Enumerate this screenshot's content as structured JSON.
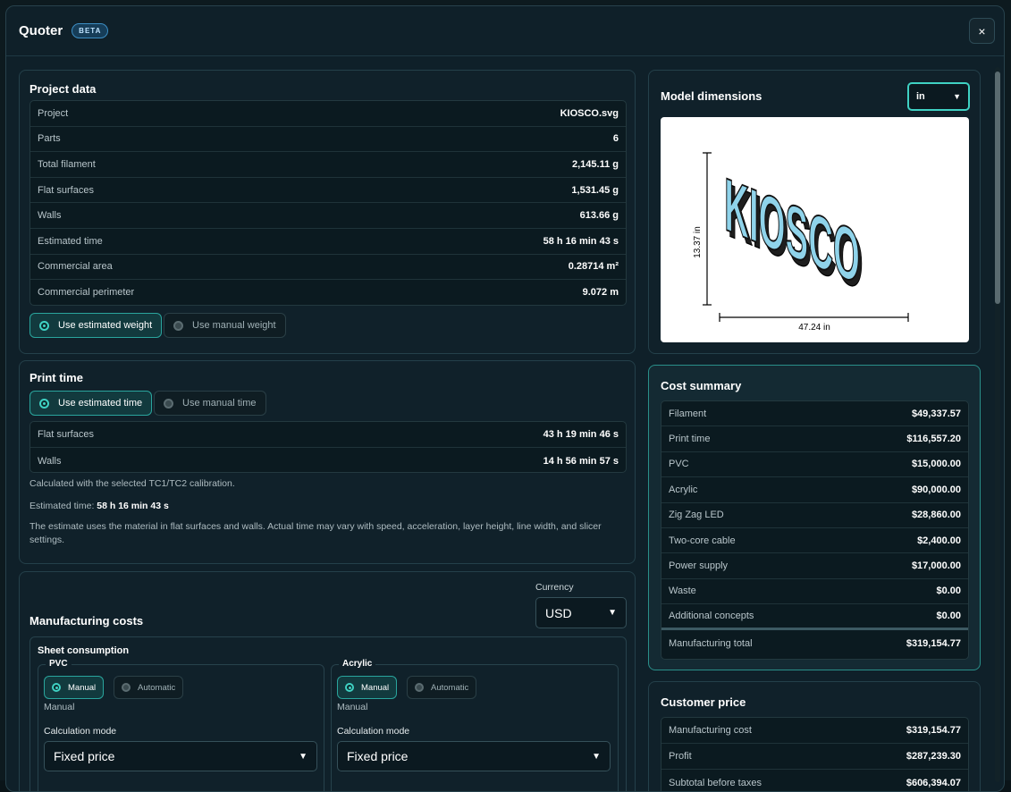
{
  "app": {
    "title": "Quoter",
    "badge": "BETA",
    "close_icon": "×"
  },
  "project_data": {
    "title": "Project data",
    "rows": [
      {
        "label": "Project",
        "value": "KIOSCO.svg"
      },
      {
        "label": "Parts",
        "value": "6"
      },
      {
        "label": "Total filament",
        "value": "2,145.11 g"
      },
      {
        "label": "Flat surfaces",
        "value": "1,531.45 g"
      },
      {
        "label": "Walls",
        "value": "613.66 g"
      },
      {
        "label": "Estimated time",
        "value": "58 h 16 min 43 s"
      },
      {
        "label": "Commercial area",
        "value": "0.28714 m²"
      },
      {
        "label": "Commercial perimeter",
        "value": "9.072 m"
      }
    ],
    "weight_options": [
      "Use estimated weight",
      "Use manual weight"
    ]
  },
  "print_time": {
    "title": "Print time",
    "options": [
      "Use estimated time",
      "Use manual time"
    ],
    "rows": [
      {
        "label": "Flat surfaces",
        "value": "43 h 19 min 46 s"
      },
      {
        "label": "Walls",
        "value": "14 h 56 min 57 s"
      }
    ],
    "calibration_note": "Calculated with the selected TC1/TC2 calibration.",
    "estimated_label": "Estimated time: ",
    "estimated_value": "58 h 16 min 43 s",
    "disclaimer": "The estimate uses the material in flat surfaces and walls. Actual time may vary with speed, acceleration, layer height, line width, and slicer settings."
  },
  "manufacturing": {
    "title": "Manufacturing costs",
    "currency_label": "Currency",
    "currency_value": "USD",
    "sheet_title": "Sheet consumption",
    "pvc": {
      "legend": "PVC",
      "options": [
        "Manual",
        "Automatic"
      ],
      "mode_text": "Manual",
      "calc_label": "Calculation mode",
      "calc_value": "Fixed price"
    },
    "acrylic": {
      "legend": "Acrylic",
      "options": [
        "Manual",
        "Automatic"
      ],
      "mode_text": "Manual",
      "calc_label": "Calculation mode",
      "calc_value": "Fixed price"
    }
  },
  "model": {
    "title": "Model dimensions",
    "unit": "in",
    "text": "KIOSCO",
    "height_label": "13.37 in",
    "width_label": "47.24 in"
  },
  "cost_summary": {
    "title": "Cost summary",
    "rows": [
      {
        "label": "Filament",
        "value": "$49,337.57"
      },
      {
        "label": "Print time",
        "value": "$116,557.20"
      },
      {
        "label": "PVC",
        "value": "$15,000.00"
      },
      {
        "label": "Acrylic",
        "value": "$90,000.00"
      },
      {
        "label": "Zig Zag LED",
        "value": "$28,860.00"
      },
      {
        "label": "Two-core cable",
        "value": "$2,400.00"
      },
      {
        "label": "Power supply",
        "value": "$17,000.00"
      },
      {
        "label": "Waste",
        "value": "$0.00"
      },
      {
        "label": "Additional concepts",
        "value": "$0.00"
      }
    ],
    "total_label": "Manufacturing total",
    "total_value": "$319,154.77"
  },
  "customer_price": {
    "title": "Customer price",
    "rows": [
      {
        "label": "Manufacturing cost",
        "value": "$319,154.77"
      },
      {
        "label": "Profit",
        "value": "$287,239.30"
      },
      {
        "label": "Subtotal before taxes",
        "value": "$606,394.07"
      }
    ]
  },
  "colors": {
    "accent": "#3fd1c3",
    "letter_fill": "#8fd3ea",
    "panel_bg": "#10212a"
  }
}
